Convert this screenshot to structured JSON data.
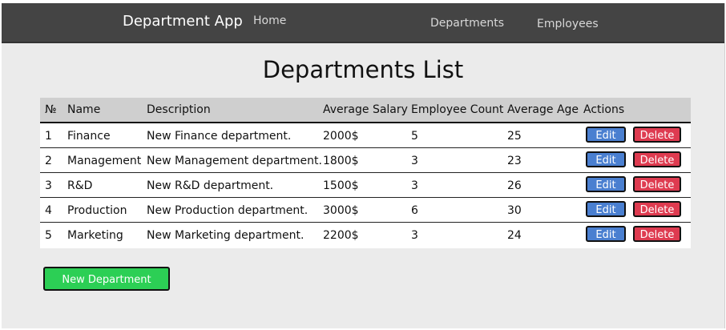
{
  "navbar": {
    "brand": "Department App",
    "links": {
      "home": "Home",
      "departments": "Departments",
      "employees": "Employees"
    }
  },
  "page": {
    "title": "Departments List"
  },
  "table": {
    "headers": {
      "num": "№",
      "name": "Name",
      "description": "Description",
      "salary": "Average Salary",
      "count": "Employee Count",
      "age": "Average Age",
      "actions": "Actions"
    },
    "rows": [
      {
        "num": "1",
        "name": "Finance",
        "description": "New Finance department.",
        "salary": "2000$",
        "count": "5",
        "age": "25"
      },
      {
        "num": "2",
        "name": "Management",
        "description": "New Management department.",
        "salary": "1800$",
        "count": "3",
        "age": "23"
      },
      {
        "num": "3",
        "name": "R&D",
        "description": "New R&D department.",
        "salary": "1500$",
        "count": "3",
        "age": "26"
      },
      {
        "num": "4",
        "name": "Production",
        "description": "New Production department.",
        "salary": "3000$",
        "count": "6",
        "age": "30"
      },
      {
        "num": "5",
        "name": "Marketing",
        "description": "New Marketing department.",
        "salary": "2200$",
        "count": "3",
        "age": "24"
      }
    ],
    "edit_label": "Edit",
    "delete_label": "Delete"
  },
  "actions": {
    "new_department": "New Department"
  },
  "colors": {
    "navbar": "#444444",
    "edit": "#4a7fd0",
    "delete": "#de3b50",
    "new": "#2ccf55"
  }
}
